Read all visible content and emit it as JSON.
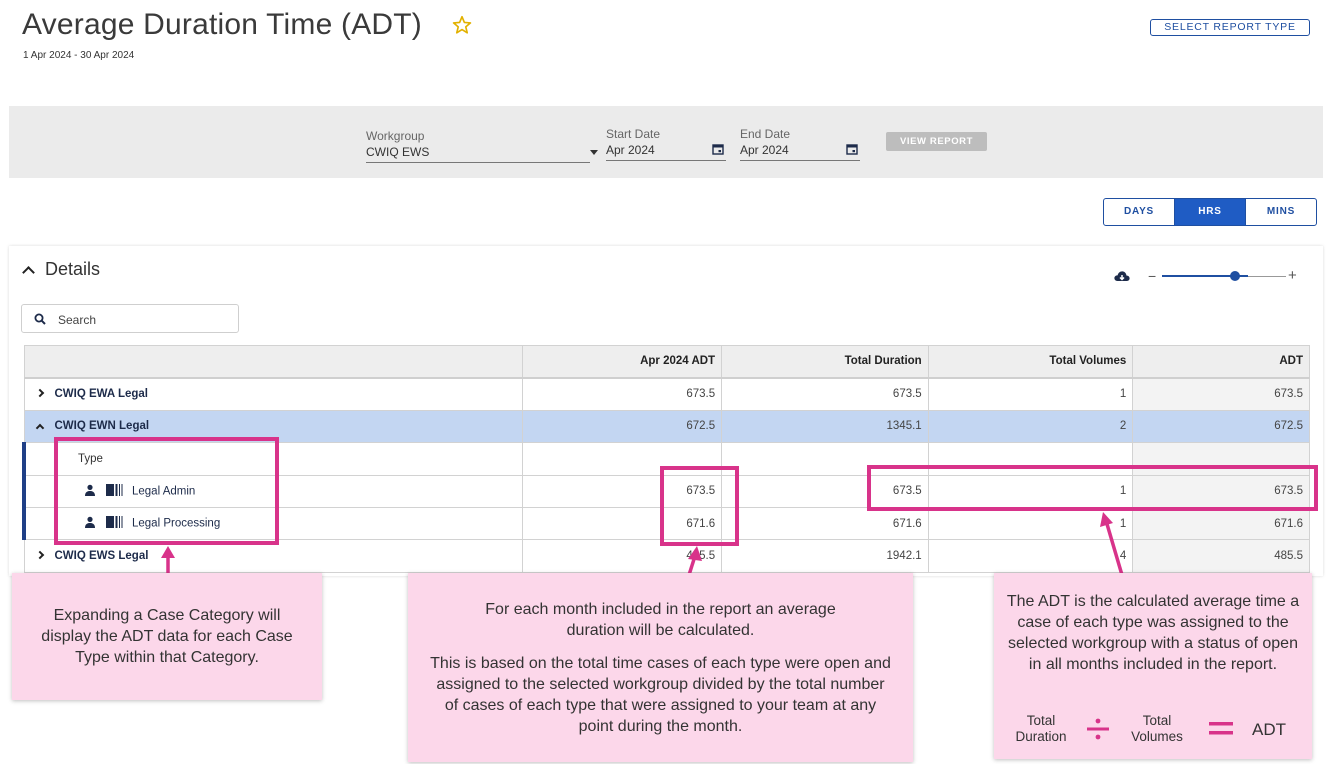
{
  "header": {
    "title": "Average Duration Time (ADT)",
    "date_range": "1 Apr 2024 - 30 Apr 2024",
    "select_report_label": "SELECT REPORT TYPE",
    "accent_color": "#1f4fa1",
    "star_color": "#e2b100"
  },
  "filters": {
    "workgroup_label": "Workgroup",
    "workgroup_value": "CWIQ EWS",
    "start_label": "Start Date",
    "start_value": "Apr 2024",
    "end_label": "End Date",
    "end_value": "Apr 2024",
    "view_report_label": "VIEW REPORT"
  },
  "units": {
    "days": "DAYS",
    "hrs": "HRS",
    "mins": "MINS",
    "active": "HRS"
  },
  "details": {
    "title": "Details",
    "search_placeholder": "Search",
    "zoom_level": 0.68
  },
  "table": {
    "headers": [
      "",
      "Apr 2024 ADT",
      "Total Duration",
      "Total Volumes",
      "ADT"
    ],
    "rows": [
      {
        "name": "CWIQ EWA Legal",
        "month_adt": "673.5",
        "total_duration": "673.5",
        "total_volumes": "1",
        "adt": "673.5"
      },
      {
        "name": "CWIQ EWN Legal",
        "month_adt": "672.5",
        "total_duration": "1345.1",
        "total_volumes": "2",
        "adt": "672.5"
      },
      {
        "name": "Type",
        "month_adt": "",
        "total_duration": "",
        "total_volumes": "",
        "adt": ""
      },
      {
        "name": "Legal Admin",
        "month_adt": "673.5",
        "total_duration": "673.5",
        "total_volumes": "1",
        "adt": "673.5"
      },
      {
        "name": "Legal Processing",
        "month_adt": "671.6",
        "total_duration": "671.6",
        "total_volumes": "1",
        "adt": "671.6"
      },
      {
        "name": "CWIQ EWS Legal",
        "month_adt": "485.5",
        "total_duration": "1942.1",
        "total_volumes": "4",
        "adt": "485.5"
      }
    ]
  },
  "callouts": {
    "left": "Expanding a Case Category will display the ADT data for each Case Type within that Category.",
    "middle_p1": "For each month included in the report an average duration will be calculated.",
    "middle_p2": "This is based on the total time cases of each type were open and assigned to the selected workgroup divided by the total number of cases of each type that were assigned to your team at any point during the month.",
    "right": "The ADT is the calculated average time a case of each type was assigned to the selected workgroup with a status of open in all months included in the report.",
    "formula_a": "Total Duration",
    "formula_b": "Total Volumes",
    "formula_result": "ADT",
    "highlight_color": "#d8338a",
    "callout_bg": "#fcd7ea"
  }
}
